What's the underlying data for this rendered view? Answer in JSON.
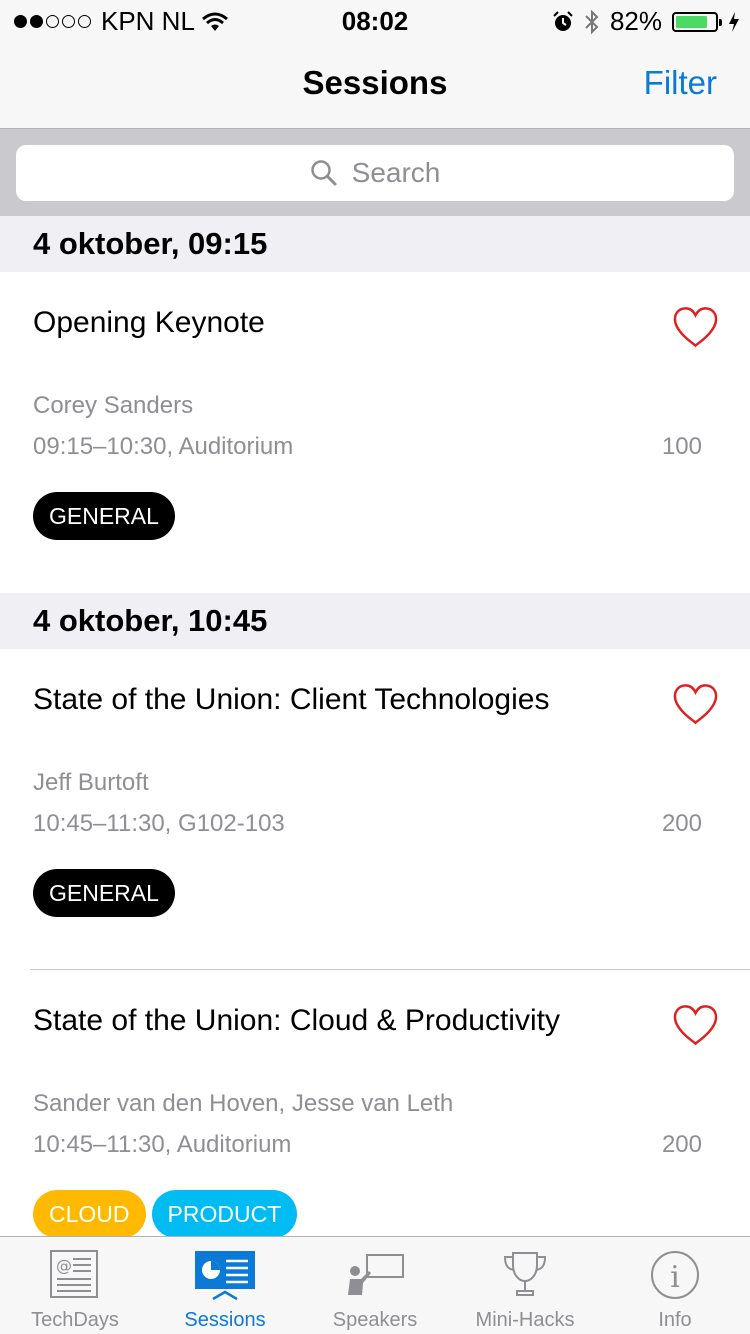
{
  "status_bar": {
    "carrier": "KPN NL",
    "time": "08:02",
    "battery": "82%",
    "battery_level": 0.82,
    "signal_bars": 2
  },
  "nav": {
    "title": "Sessions",
    "filter_label": "Filter"
  },
  "search": {
    "placeholder": "Search"
  },
  "sections": [
    {
      "header": "4 oktober, 09:15",
      "sessions": [
        {
          "title": "Opening Keynote",
          "speaker": "Corey Sanders",
          "time": "09:15–10:30, Auditorium",
          "count": "100",
          "tags": [
            {
              "label": "GENERAL",
              "color": "#000000"
            }
          ]
        }
      ]
    },
    {
      "header": "4 oktober, 10:45",
      "sessions": [
        {
          "title": "State of the Union: Client Technologies",
          "speaker": "Jeff Burtoft",
          "time": "10:45–11:30, G102-103",
          "count": "200",
          "tags": [
            {
              "label": "GENERAL",
              "color": "#000000"
            }
          ]
        },
        {
          "title": "State of the Union: Cloud & Productivity",
          "speaker": "Sander van den Hoven, Jesse van Leth",
          "time": "10:45–11:30, Auditorium",
          "count": "200",
          "tags": [
            {
              "label": "CLOUD",
              "color": "#ffb900"
            },
            {
              "label": "PRODUCT",
              "color": "#00bcf2"
            }
          ]
        }
      ]
    }
  ],
  "tabs": [
    {
      "label": "TechDays",
      "icon": "newspaper-icon"
    },
    {
      "label": "Sessions",
      "icon": "presentation-icon",
      "active": true
    },
    {
      "label": "Speakers",
      "icon": "speaker-icon"
    },
    {
      "label": "Mini-Hacks",
      "icon": "trophy-icon"
    },
    {
      "label": "Info",
      "icon": "info-icon"
    }
  ],
  "colors": {
    "accent": "#0a7ad6",
    "heart": "#e02020",
    "secondary_text": "#8e8e93"
  }
}
